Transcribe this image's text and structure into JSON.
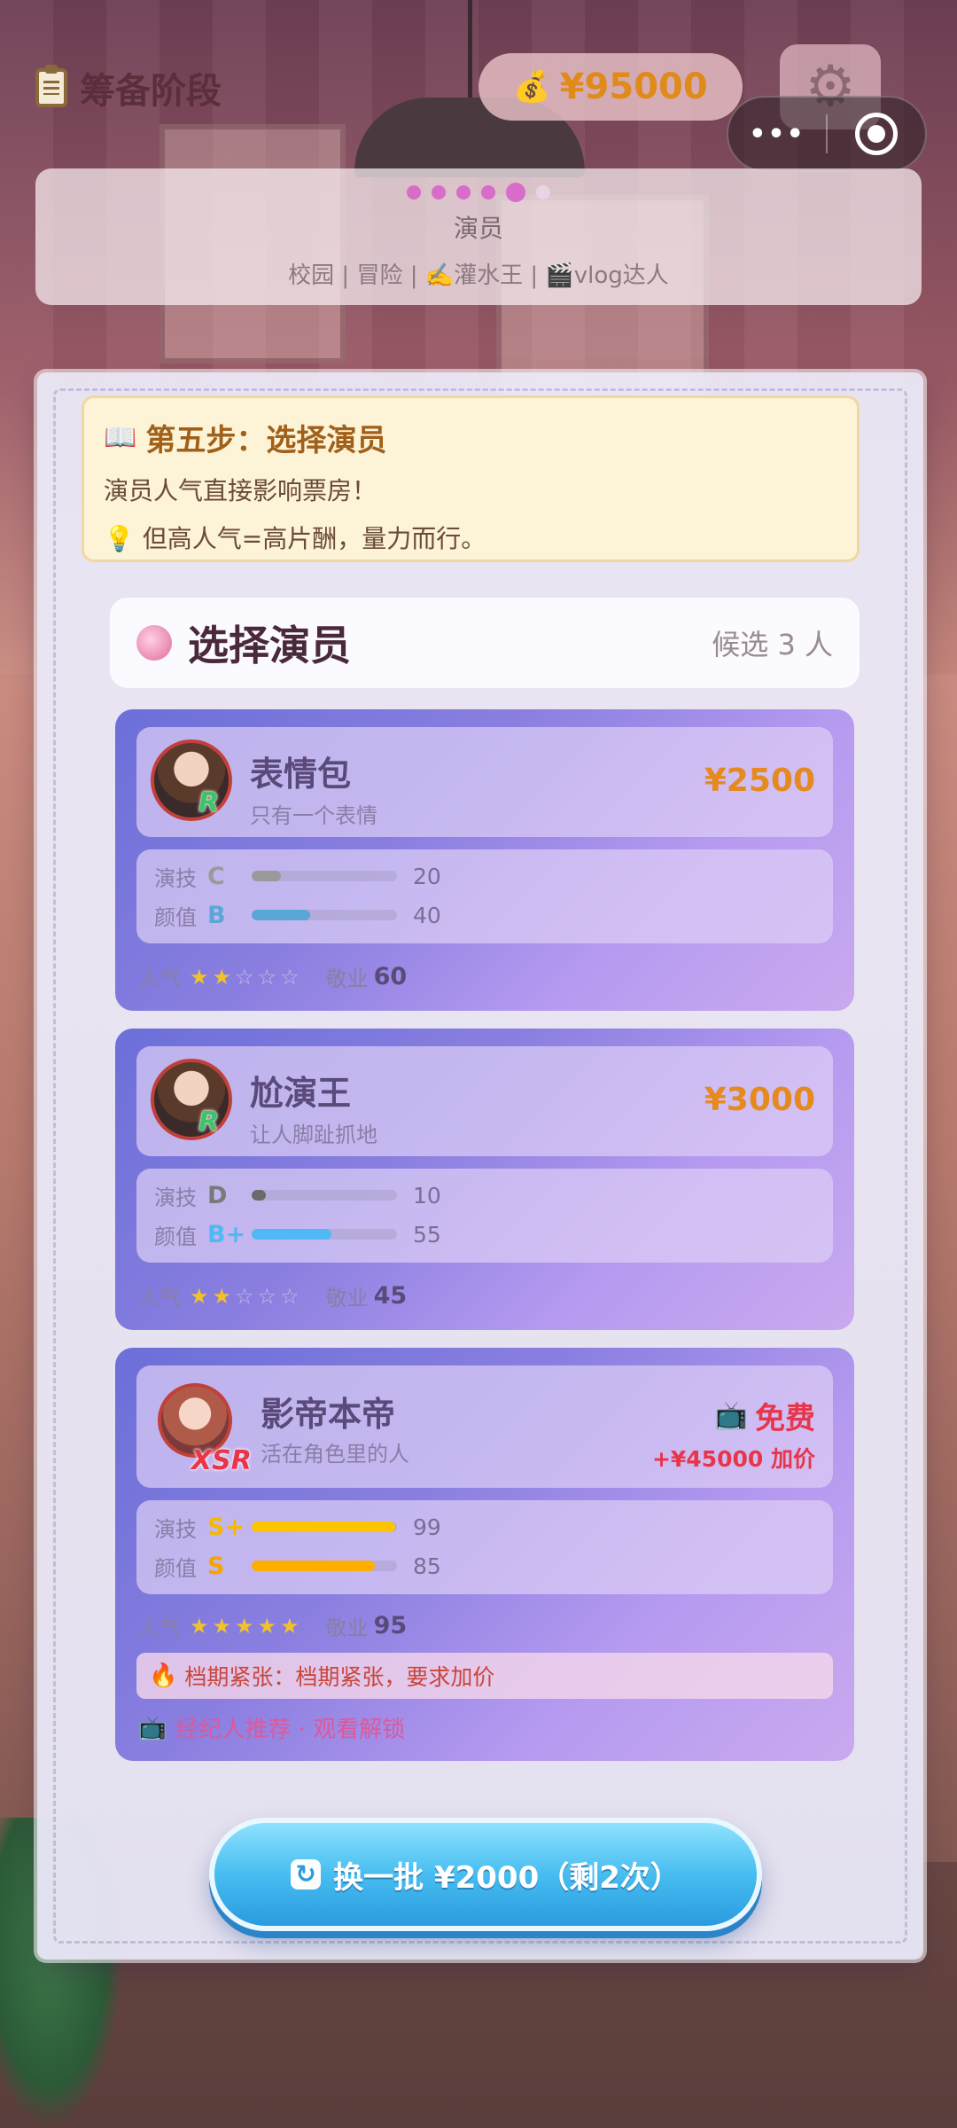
{
  "header": {
    "stage_title": "筹备阶段",
    "money": "¥95000"
  },
  "progress": {
    "current_step_label": "演员",
    "tags": "校园 | 冒险 | ✍️灌水王 | 🎬vlog达人",
    "steps_total": 6,
    "steps_done": 5
  },
  "tip": {
    "title": "第五步：选择演员",
    "line1": "演员人气直接影响票房！",
    "line2": "但高人气=高片酬，量力而行。"
  },
  "section": {
    "title": "选择演员",
    "candidate_count": "候选 3 人"
  },
  "actors": [
    {
      "name": "表情包",
      "desc": "只有一个表情",
      "rarity": "R",
      "price": "¥2500",
      "acting_label": "演技",
      "acting_grade": "C",
      "acting_value": 20,
      "looks_label": "颜值",
      "looks_grade": "B",
      "looks_value": 40,
      "popularity_label": "人气",
      "stars": 2,
      "dedication_label": "敬业",
      "dedication": "60"
    },
    {
      "name": "尬演王",
      "desc": "让人脚趾抓地",
      "rarity": "R",
      "price": "¥3000",
      "acting_label": "演技",
      "acting_grade": "D",
      "acting_value": 10,
      "looks_label": "颜值",
      "looks_grade": "B+",
      "looks_value": 55,
      "popularity_label": "人气",
      "stars": 2,
      "dedication_label": "敬业",
      "dedication": "45"
    },
    {
      "name": "影帝本帝",
      "desc": "活在角色里的人",
      "rarity": "XSR",
      "price": "免费",
      "extra_price": "+¥45000 加价",
      "acting_label": "演技",
      "acting_grade": "S+",
      "acting_value": 99,
      "looks_label": "颜值",
      "looks_grade": "S",
      "looks_value": 85,
      "popularity_label": "人气",
      "stars": 5,
      "dedication_label": "敬业",
      "dedication": "95",
      "alert": "档期紧张：档期紧张，要求加价",
      "unlock": "经纪人推荐 · 观看解锁"
    }
  ],
  "refresh_button": "换一批 ¥2000（剩2次）",
  "colors": {
    "grade_C": "#9a9a9a",
    "grade_B": "#5aa6d6",
    "grade_D": "#7a7a7a",
    "grade_Bplus": "#4fb8f5",
    "grade_S": "#f5b800",
    "price": "#e48a1e",
    "free": "#e8354a"
  }
}
